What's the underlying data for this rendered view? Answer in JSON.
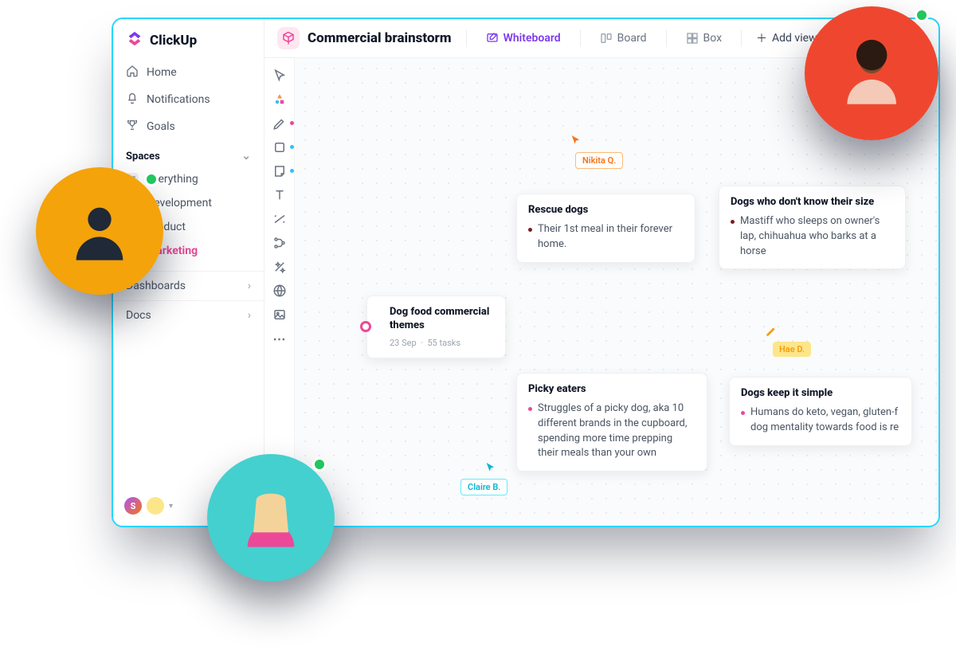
{
  "brand": {
    "name": "ClickUp"
  },
  "sidebar": {
    "home": "Home",
    "notifications": "Notifications",
    "goals": "Goals",
    "spaces_title": "Spaces",
    "items": [
      {
        "label": "Everything",
        "icon_letter": "",
        "color": "#e5e7eb",
        "active": false
      },
      {
        "label": "Development",
        "icon_letter": "D",
        "color": "#22d3ee",
        "active": false
      },
      {
        "label": "Product",
        "icon_letter": "P",
        "color": "#10b981",
        "active": false
      },
      {
        "label": "Marketing",
        "icon_letter": "M",
        "color": "#ec4899",
        "active": true
      }
    ],
    "dashboards": "Dashboards",
    "docs": "Docs"
  },
  "topbar": {
    "title": "Commercial brainstorm",
    "views": {
      "whiteboard": "Whiteboard",
      "board": "Board",
      "box": "Box",
      "add": "Add view"
    }
  },
  "toolbox": [
    "pointer-icon",
    "shapes-icon",
    "pen-icon",
    "square-icon",
    "note-icon",
    "text-icon",
    "connector-icon",
    "branch-icon",
    "magic-icon",
    "globe-icon",
    "image-icon",
    "more-icon"
  ],
  "canvas": {
    "root": {
      "title": "Dog food commercial themes",
      "date": "23 Sep",
      "tasks": "55 tasks"
    },
    "cards": {
      "rescue": {
        "title": "Rescue dogs",
        "items": [
          "Their 1st meal in their forever home."
        ]
      },
      "size": {
        "title": "Dogs who don't know their size",
        "items": [
          "Mastiff who sleeps on owner's lap, chihuahua who barks at a horse"
        ]
      },
      "picky": {
        "title": "Picky eaters",
        "items": [
          "Struggles of a picky dog, aka 10 different brands in the cupboard, spending more time prepping their meals than your own"
        ]
      },
      "simple": {
        "title": "Dogs keep it simple",
        "items": [
          "Humans do keto, vegan, gluten-f dog mentality towards food is re"
        ]
      }
    },
    "cursors": {
      "nikita": "Nikita Q.",
      "claire": "Claire B.",
      "hae": "Hae D."
    }
  }
}
